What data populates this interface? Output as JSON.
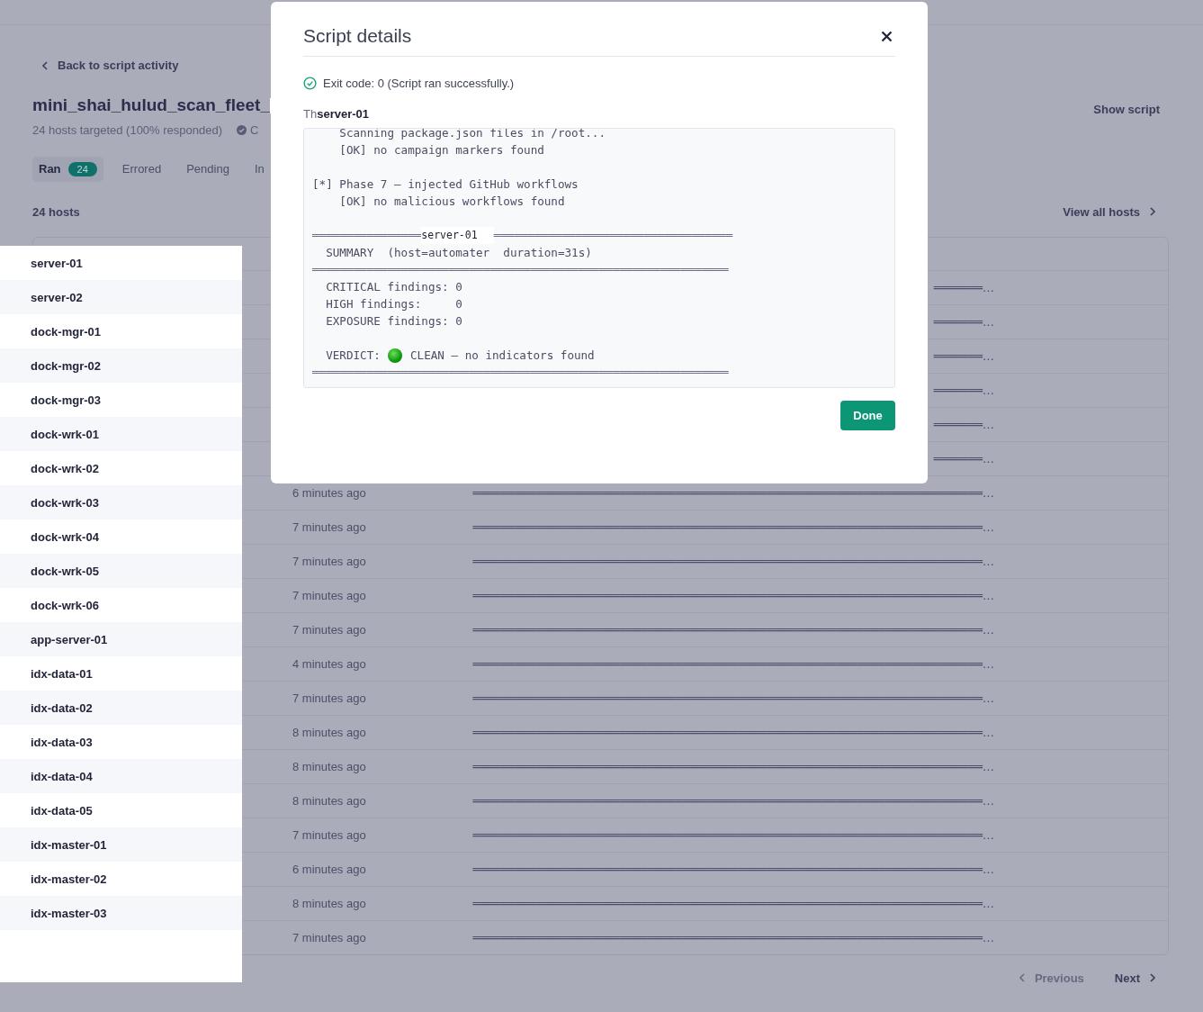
{
  "page": {
    "back_link": "Back to script activity",
    "title": "mini_shai_hulud_scan_fleet_",
    "subtitle": "24 hosts targeted (100% responded)",
    "status_text": "C",
    "show_script": "Show script",
    "tabs": [
      {
        "label": "Ran",
        "count": "24",
        "selected": true
      },
      {
        "label": "Errored",
        "selected": false
      },
      {
        "label": "Pending",
        "selected": false
      },
      {
        "label": "In",
        "selected": false
      }
    ],
    "hosts_count": "24 hosts",
    "view_all": "View all hosts",
    "table": {
      "rows": [
        {
          "output": "═══════…"
        },
        {
          "output": "═══════…"
        },
        {
          "output": "═══════…"
        },
        {
          "output": "═══════…"
        },
        {
          "output": "═══════…"
        },
        {
          "output": "═══════…"
        },
        {
          "time": "6 minutes ago",
          "output": "═════════════════════════════════════════════════════════════════════════…"
        },
        {
          "time": "7 minutes ago",
          "output": "═════════════════════════════════════════════════════════════════════════…"
        },
        {
          "time": "7 minutes ago",
          "output": "═════════════════════════════════════════════════════════════════════════…"
        },
        {
          "time": "7 minutes ago",
          "output": "═════════════════════════════════════════════════════════════════════════…"
        },
        {
          "time": "7 minutes ago",
          "output": "═════════════════════════════════════════════════════════════════════════…"
        },
        {
          "time": "4 minutes ago",
          "output": "═════════════════════════════════════════════════════════════════════════…"
        },
        {
          "time": "7 minutes ago",
          "output": "═════════════════════════════════════════════════════════════════════════…"
        },
        {
          "time": "8 minutes ago",
          "output": "═════════════════════════════════════════════════════════════════════════…"
        },
        {
          "time": "8 minutes ago",
          "output": "═════════════════════════════════════════════════════════════════════════…"
        },
        {
          "time": "8 minutes ago",
          "output": "═════════════════════════════════════════════════════════════════════════…"
        },
        {
          "time": "7 minutes ago",
          "output": "═════════════════════════════════════════════════════════════════════════…"
        },
        {
          "time": "6 minutes ago",
          "output": "═════════════════════════════════════════════════════════════════════════…"
        },
        {
          "time": "8 minutes ago",
          "output": "═════════════════════════════════════════════════════════════════════════…"
        },
        {
          "time": "7 minutes ago",
          "output": "═════════════════════════════════════════════════════════════════════════…"
        }
      ]
    },
    "pagination": {
      "previous": {
        "label": "Previous",
        "disabled": true
      },
      "next": {
        "label": "Next",
        "disabled": false
      }
    }
  },
  "host_panel": {
    "hosts": [
      "server-01",
      "server-02",
      "dock-mgr-01",
      "dock-mgr-02",
      "dock-mgr-03",
      "dock-wrk-01",
      "dock-wrk-02",
      "dock-wrk-03",
      "dock-wrk-04",
      "dock-wrk-05",
      "dock-wrk-06",
      "app-server-01",
      "idx-data-01",
      "idx-data-02",
      "idx-data-03",
      "idx-data-04",
      "idx-data-05",
      "idx-master-01",
      "idx-master-02",
      "idx-master-03"
    ]
  },
  "modal": {
    "title": "Script details",
    "exit_code": "Exit code: 0 (Script ran successfully.)",
    "host_prefix": "Th",
    "host_label": "server-01",
    "output": [
      {
        "kind": "text",
        "text": "    Scanning package.json files in /root..."
      },
      {
        "kind": "text",
        "text": "    [OK] no campaign markers found"
      },
      {
        "kind": "blank"
      },
      {
        "kind": "text",
        "text": "[*] Phase 7 — injected GitHub workflows"
      },
      {
        "kind": "text",
        "text": "    [OK] no malicious workflows found"
      },
      {
        "kind": "blank"
      },
      {
        "kind": "labeled_rule",
        "left": "════════════════",
        "label": "server-01",
        "right": "═══════════════════════════════════"
      },
      {
        "kind": "text",
        "text": "  SUMMARY  (host=automater  duration=31s)"
      },
      {
        "kind": "rule",
        "text": "═════════════════════════════════════════════════════════════"
      },
      {
        "kind": "text",
        "text": "  CRITICAL findings: 0"
      },
      {
        "kind": "text",
        "text": "  HIGH findings:     0"
      },
      {
        "kind": "text",
        "text": "  EXPOSURE findings: 0"
      },
      {
        "kind": "blank"
      },
      {
        "kind": "verdict",
        "prefix": "  VERDICT: ",
        "suffix": " CLEAN — no indicators found"
      },
      {
        "kind": "rule",
        "text": "═════════════════════════════════════════════════════════════"
      }
    ],
    "done": "Done"
  }
}
